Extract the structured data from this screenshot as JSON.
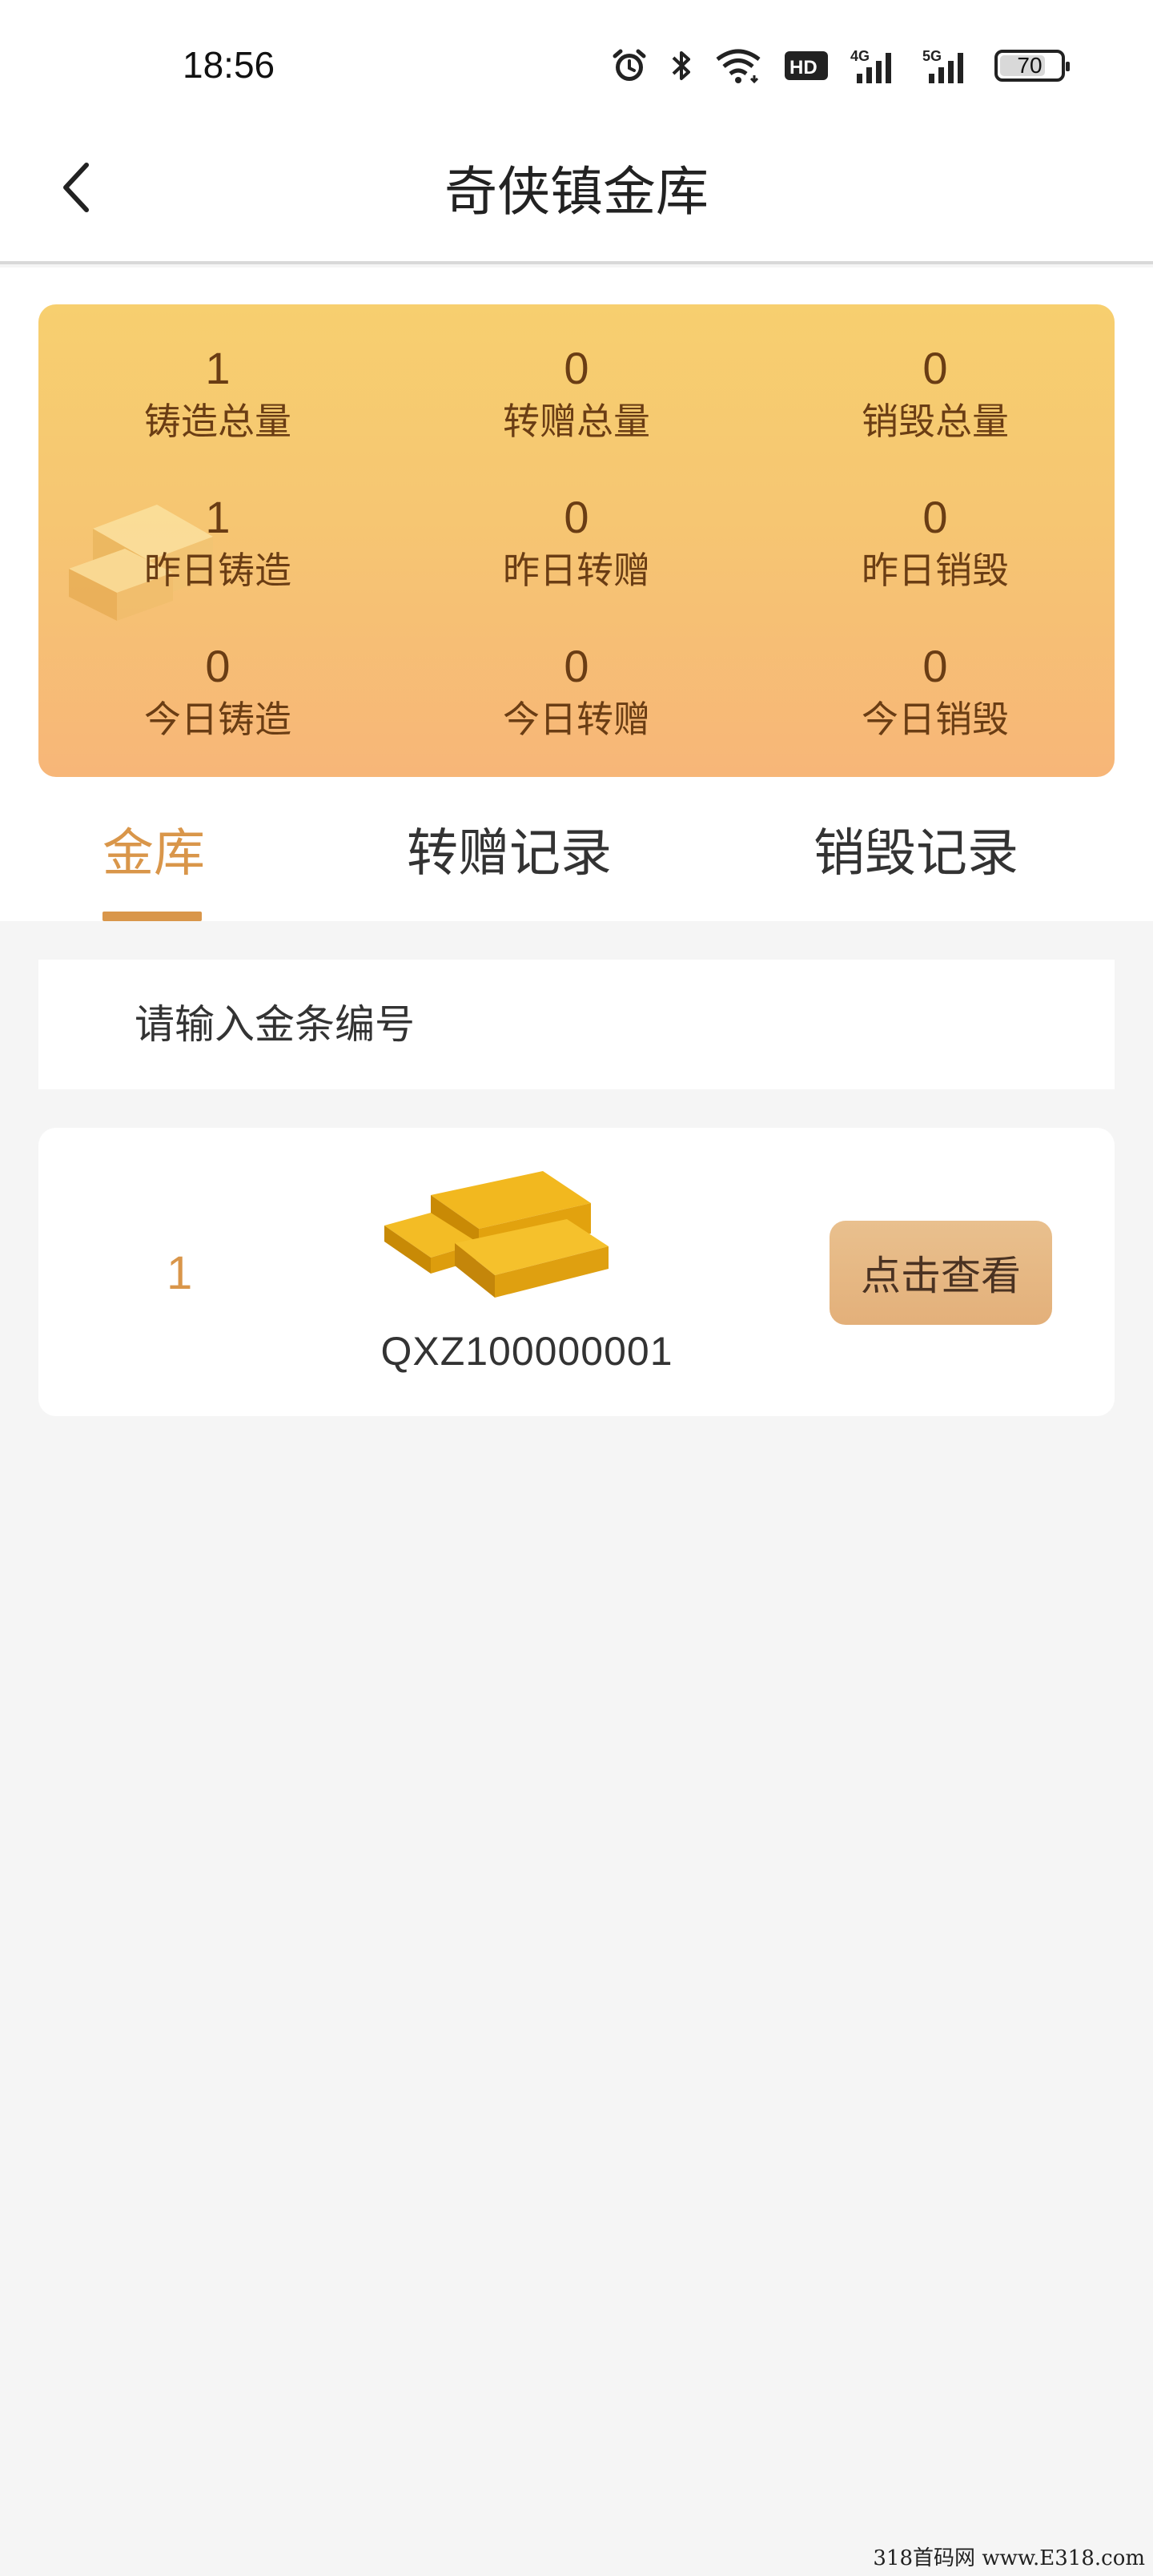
{
  "status_bar": {
    "time": "18:56",
    "battery": "70",
    "icons": [
      "alarm-icon",
      "bluetooth-icon",
      "wifi-icon",
      "hd-icon",
      "4g-signal-icon",
      "5g-signal-icon"
    ]
  },
  "header": {
    "title": "奇侠镇金库",
    "back_icon": "chevron-left-icon"
  },
  "stats": {
    "cast_total": {
      "value": "1",
      "label": "铸造总量"
    },
    "gift_total": {
      "value": "0",
      "label": "转赠总量"
    },
    "destroy_total": {
      "value": "0",
      "label": "销毁总量"
    },
    "cast_yesterday": {
      "value": "1",
      "label": "昨日铸造"
    },
    "gift_yesterday": {
      "value": "0",
      "label": "昨日转赠"
    },
    "destroy_yesterday": {
      "value": "0",
      "label": "昨日销毁"
    },
    "cast_today": {
      "value": "0",
      "label": "今日铸造"
    },
    "gift_today": {
      "value": "0",
      "label": "今日转赠"
    },
    "destroy_today": {
      "value": "0",
      "label": "今日销毁"
    }
  },
  "tabs": [
    {
      "label": "金库",
      "active": true
    },
    {
      "label": "转赠记录",
      "active": false
    },
    {
      "label": "销毁记录",
      "active": false
    }
  ],
  "search": {
    "placeholder": "请输入金条编号",
    "value": ""
  },
  "items": [
    {
      "index": "1",
      "code": "QXZ100000001",
      "button_label": "点击查看"
    }
  ],
  "colors": {
    "accent": "#d9964a",
    "card_gradient_top": "#f7cf6f",
    "card_gradient_bottom": "#f7b678",
    "button": "#e6b985"
  },
  "watermark": "318首码网 www.E318.com"
}
